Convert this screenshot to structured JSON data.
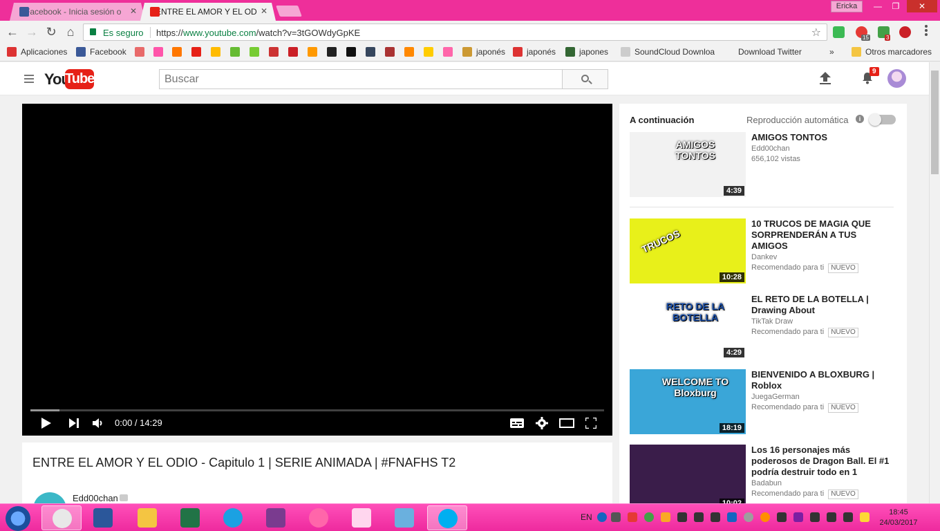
{
  "browser": {
    "tabs": [
      {
        "label": "Facebook - Inicia sesión o",
        "favicon_color": "#3b5998"
      },
      {
        "label": "ENTRE EL AMOR Y EL OD",
        "favicon_color": "#e62117"
      }
    ],
    "profile_name": "Ericka",
    "window_buttons": {
      "minimize": "—",
      "maximize": "❐",
      "close": "✕"
    },
    "secure_label": "Es seguro",
    "url_scheme": "https://",
    "url_host": "www.youtube.com",
    "url_path": "/watch?v=3tGOWdyGpKE",
    "ext_badges": [
      "15",
      "3"
    ],
    "bookmarks": [
      {
        "label": "Aplicaciones",
        "icon": "apps-grid-icon",
        "color": "#d33"
      },
      {
        "label": "Facebook",
        "icon": "facebook-icon",
        "color": "#3b5998"
      },
      {
        "label": "",
        "icon": "bookmark-icon",
        "color": "#e86a6a"
      },
      {
        "label": "",
        "icon": "bookmark-icon",
        "color": "#f5a"
      },
      {
        "label": "",
        "icon": "soundcloud-icon",
        "color": "#f70"
      },
      {
        "label": "",
        "icon": "youtube-icon",
        "color": "#e62117"
      },
      {
        "label": "",
        "icon": "bookmark-icon",
        "color": "#fb0"
      },
      {
        "label": "",
        "icon": "download-icon",
        "color": "#6b3"
      },
      {
        "label": "",
        "icon": "bookmark-icon",
        "color": "#7c3"
      },
      {
        "label": "",
        "icon": "bookmark-icon",
        "color": "#c33"
      },
      {
        "label": "",
        "icon": "pinterest-icon",
        "color": "#cb2027"
      },
      {
        "label": "",
        "icon": "bookmark-icon",
        "color": "#f90"
      },
      {
        "label": "",
        "icon": "bookmark-icon",
        "color": "#222"
      },
      {
        "label": "",
        "icon": "bookmark-icon",
        "color": "#111"
      },
      {
        "label": "",
        "icon": "tumblr-icon",
        "color": "#36465d"
      },
      {
        "label": "",
        "icon": "bookmark-icon",
        "color": "#a33"
      },
      {
        "label": "",
        "icon": "bookmark-icon",
        "color": "#f80"
      },
      {
        "label": "",
        "icon": "bookmark-icon",
        "color": "#fc0"
      },
      {
        "label": "",
        "icon": "osu-icon",
        "color": "#f6a"
      },
      {
        "label": "japonés",
        "icon": "bookmark-icon",
        "color": "#c93"
      },
      {
        "label": "japonés",
        "icon": "bookmark-icon",
        "color": "#d33"
      },
      {
        "label": "japones",
        "icon": "bookmark-icon",
        "color": "#363"
      },
      {
        "label": "SoundCloud Downloa",
        "icon": "page-icon",
        "color": "#ccc"
      },
      {
        "label": "Download Twitter",
        "icon": "",
        "color": "#ccc"
      },
      {
        "label": "»",
        "icon": "",
        "color": ""
      },
      {
        "label": "Otros marcadores",
        "icon": "folder-icon",
        "color": "#f4c542"
      }
    ]
  },
  "youtube": {
    "logo_you": "You",
    "logo_tube": "Tube",
    "search_placeholder": "Buscar",
    "notification_count": "9"
  },
  "player": {
    "time": "0:00 / 14:29",
    "progress": 0.05
  },
  "video": {
    "title": "ENTRE EL AMOR Y EL ODIO - Capitulo 1 | SERIE ANIMADA | #FNAFHS T2",
    "channel": "Edd00chan"
  },
  "sidebar": {
    "up_next": "A continuación",
    "autoplay": "Reproducción automática",
    "videos": [
      {
        "title": "AMIGOS TONTOS",
        "channel": "Edd00chan",
        "meta": "656,102 vistas",
        "badge": "",
        "duration": "4:39",
        "thumb_bg": "#f2f2f2",
        "thumb_text": "AMIGOS TONTOS"
      },
      {
        "title": "10 TRUCOS DE MAGIA QUE SORPRENDERÁN A TUS AMIGOS",
        "channel": "Dankev",
        "meta": "Recomendado para ti",
        "badge": "NUEVO",
        "duration": "10:28",
        "thumb_bg": "#e8f01a",
        "thumb_text": "TRUCOS"
      },
      {
        "title": "EL RETO DE LA BOTELLA | Drawing About",
        "channel": "TikTak Draw",
        "meta": "Recomendado para ti",
        "badge": "NUEVO",
        "duration": "4:29",
        "thumb_bg": "#ffffff",
        "thumb_text": "RETO DE LA BOTELLA"
      },
      {
        "title": "BIENVENIDO A BLOXBURG | Roblox",
        "channel": "JuegaGerman",
        "meta": "Recomendado para ti",
        "badge": "NUEVO",
        "duration": "18:19",
        "thumb_bg": "#3aa6d8",
        "thumb_text": "WELCOME TO Bloxburg"
      },
      {
        "title": "Los 16 personajes más poderosos de Dragon Ball. El #1 podría destruir todo en 1",
        "channel": "Badabun",
        "meta": "Recomendado para ti",
        "badge": "NUEVO",
        "duration": "10:02",
        "thumb_bg": "#3a1d4a",
        "thumb_text": ""
      }
    ]
  },
  "taskbar": {
    "apps": [
      {
        "name": "chrome",
        "color": "#e8e8e8",
        "active": true
      },
      {
        "name": "word",
        "color": "#2b579a",
        "active": false
      },
      {
        "name": "explorer",
        "color": "#f4c542",
        "active": false
      },
      {
        "name": "excel",
        "color": "#217346",
        "active": false
      },
      {
        "name": "ie",
        "color": "#1ba1e2",
        "active": false
      },
      {
        "name": "winrar",
        "color": "#7a3b8f",
        "active": false
      },
      {
        "name": "osu",
        "color": "#ff66aa",
        "active": false
      },
      {
        "name": "heart",
        "color": "#ffd6ee",
        "active": false
      },
      {
        "name": "network",
        "color": "#6ab0de",
        "active": false
      },
      {
        "name": "skype",
        "color": "#00aff0",
        "active": true
      }
    ],
    "language": "EN",
    "clock_time": "18:45",
    "clock_date": "24/03/2017"
  }
}
